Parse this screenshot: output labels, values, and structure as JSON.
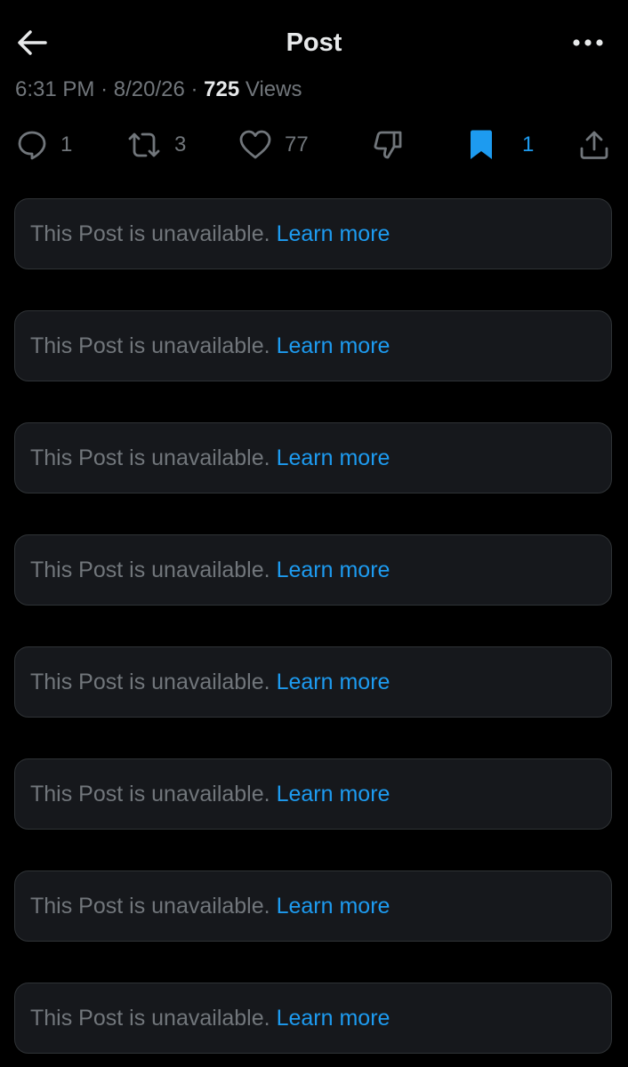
{
  "header": {
    "title": "Post",
    "back_icon": "arrow-left-icon",
    "more_icon": "more-horizontal-icon"
  },
  "meta": {
    "time": "6:31 PM",
    "separator": "·",
    "date": "8/20/26",
    "views_count": "725",
    "views_label": "Views"
  },
  "actions": {
    "reply": {
      "icon": "reply-icon",
      "count": "1"
    },
    "repost": {
      "icon": "repost-icon",
      "count": "3"
    },
    "like": {
      "icon": "heart-icon",
      "count": "77"
    },
    "dislike": {
      "icon": "thumbs-down-icon"
    },
    "bookmark": {
      "icon": "bookmark-icon",
      "count": "1"
    },
    "share": {
      "icon": "share-icon"
    }
  },
  "notices": [
    {
      "text": "This Post is unavailable.",
      "link": "Learn more"
    },
    {
      "text": "This Post is unavailable.",
      "link": "Learn more"
    },
    {
      "text": "This Post is unavailable.",
      "link": "Learn more"
    },
    {
      "text": "This Post is unavailable.",
      "link": "Learn more"
    },
    {
      "text": "This Post is unavailable.",
      "link": "Learn more"
    },
    {
      "text": "This Post is unavailable.",
      "link": "Learn more"
    },
    {
      "text": "This Post is unavailable.",
      "link": "Learn more"
    },
    {
      "text": "This Post is unavailable.",
      "link": "Learn more"
    }
  ],
  "colors": {
    "background": "#000000",
    "card": "#16181c",
    "muted_text": "#71767b",
    "primary_text": "#e7e9ea",
    "accent": "#1d9bf0"
  }
}
